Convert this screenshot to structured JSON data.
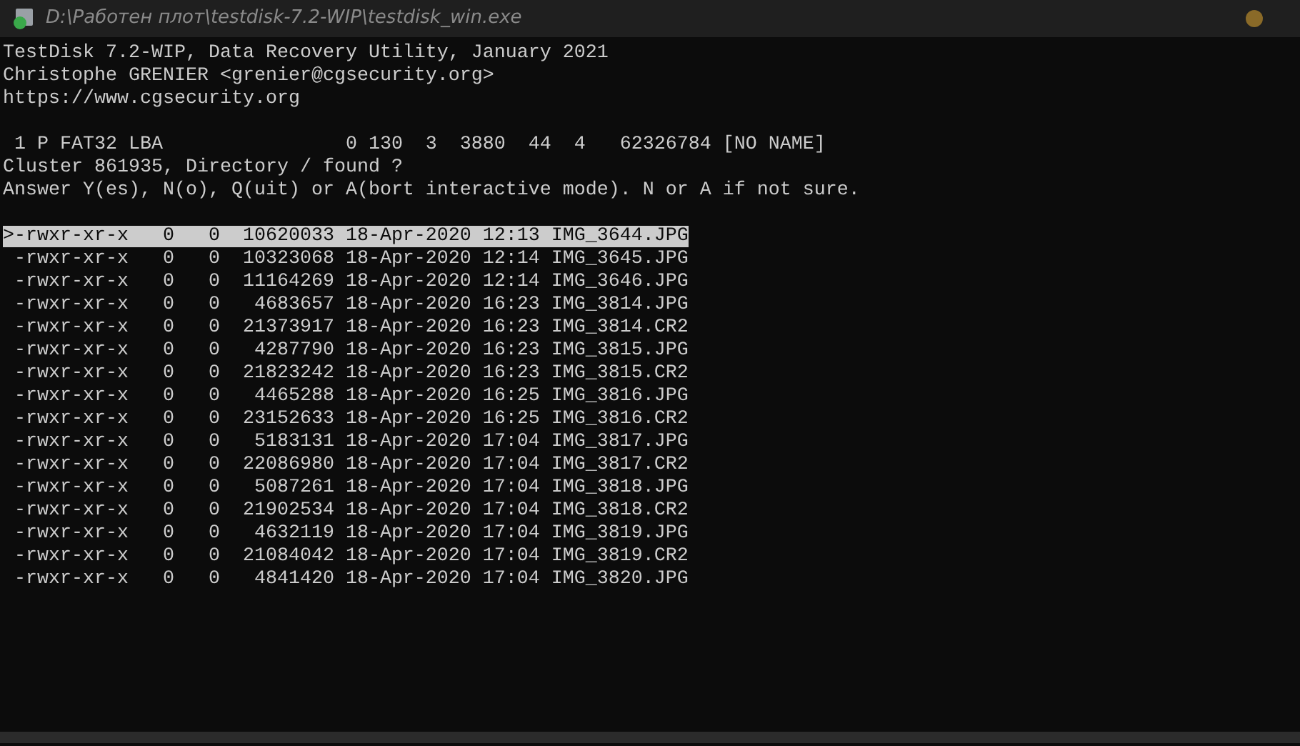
{
  "window": {
    "title": "D:\\Работен плот\\testdisk-7.2-WIP\\testdisk_win.exe"
  },
  "header_lines": [
    "TestDisk 7.2-WIP, Data Recovery Utility, January 2021",
    "Christophe GRENIER <grenier@cgsecurity.org>",
    "https://www.cgsecurity.org"
  ],
  "partition_line": " 1 P FAT32 LBA                0 130  3  3880  44  4   62326784 [NO NAME]",
  "prompt_lines": [
    "Cluster 861935, Directory / found ?",
    "Answer Y(es), N(o), Q(uit) or A(bort interactive mode). N or A if not sure."
  ],
  "files": [
    {
      "text": ">-rwxr-xr-x   0   0  10620033 18-Apr-2020 12:13 IMG_3644.JPG",
      "selected": true
    },
    {
      "text": " -rwxr-xr-x   0   0  10323068 18-Apr-2020 12:14 IMG_3645.JPG",
      "selected": false
    },
    {
      "text": " -rwxr-xr-x   0   0  11164269 18-Apr-2020 12:14 IMG_3646.JPG",
      "selected": false
    },
    {
      "text": " -rwxr-xr-x   0   0   4683657 18-Apr-2020 16:23 IMG_3814.JPG",
      "selected": false
    },
    {
      "text": " -rwxr-xr-x   0   0  21373917 18-Apr-2020 16:23 IMG_3814.CR2",
      "selected": false
    },
    {
      "text": " -rwxr-xr-x   0   0   4287790 18-Apr-2020 16:23 IMG_3815.JPG",
      "selected": false
    },
    {
      "text": " -rwxr-xr-x   0   0  21823242 18-Apr-2020 16:23 IMG_3815.CR2",
      "selected": false
    },
    {
      "text": " -rwxr-xr-x   0   0   4465288 18-Apr-2020 16:25 IMG_3816.JPG",
      "selected": false
    },
    {
      "text": " -rwxr-xr-x   0   0  23152633 18-Apr-2020 16:25 IMG_3816.CR2",
      "selected": false
    },
    {
      "text": " -rwxr-xr-x   0   0   5183131 18-Apr-2020 17:04 IMG_3817.JPG",
      "selected": false
    },
    {
      "text": " -rwxr-xr-x   0   0  22086980 18-Apr-2020 17:04 IMG_3817.CR2",
      "selected": false
    },
    {
      "text": " -rwxr-xr-x   0   0   5087261 18-Apr-2020 17:04 IMG_3818.JPG",
      "selected": false
    },
    {
      "text": " -rwxr-xr-x   0   0  21902534 18-Apr-2020 17:04 IMG_3818.CR2",
      "selected": false
    },
    {
      "text": " -rwxr-xr-x   0   0   4632119 18-Apr-2020 17:04 IMG_3819.JPG",
      "selected": false
    },
    {
      "text": " -rwxr-xr-x   0   0  21084042 18-Apr-2020 17:04 IMG_3819.CR2",
      "selected": false
    },
    {
      "text": " -rwxr-xr-x   0   0   4841420 18-Apr-2020 17:04 IMG_3820.JPG",
      "selected": false
    }
  ]
}
